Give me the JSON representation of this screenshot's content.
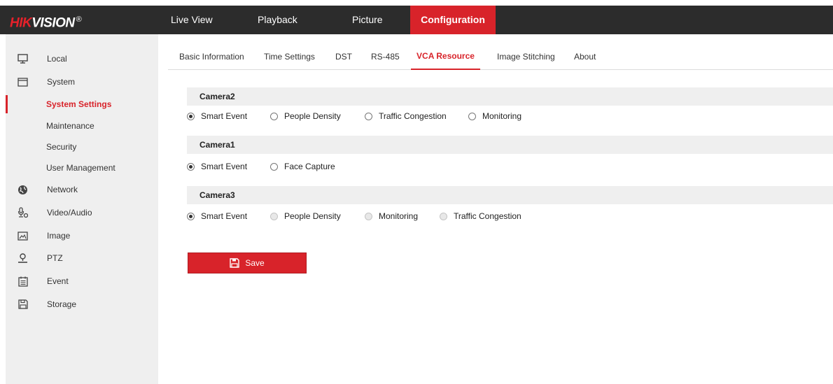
{
  "brand": {
    "hik": "HIK",
    "vision": "VISION",
    "reg": "®"
  },
  "topnav": {
    "live_view": "Live View",
    "playback": "Playback",
    "picture": "Picture",
    "configuration": "Configuration"
  },
  "sidebar": {
    "items": [
      {
        "label": "Local",
        "icon": "monitor-icon"
      },
      {
        "label": "System",
        "icon": "window-icon"
      },
      {
        "label": "System Settings",
        "active": true
      },
      {
        "label": "Maintenance"
      },
      {
        "label": "Security"
      },
      {
        "label": "User Management"
      },
      {
        "label": "Network",
        "icon": "globe-icon"
      },
      {
        "label": "Video/Audio",
        "icon": "microphone-icon"
      },
      {
        "label": "Image",
        "icon": "image-icon"
      },
      {
        "label": "PTZ",
        "icon": "ptz-camera-icon"
      },
      {
        "label": "Event",
        "icon": "calendar-icon"
      },
      {
        "label": "Storage",
        "icon": "floppy-disk-icon"
      }
    ]
  },
  "tabs": {
    "basic_information": "Basic Information",
    "time_settings": "Time Settings",
    "dst": "DST",
    "rs485": "RS-485",
    "vca_resource": "VCA Resource",
    "image_stitching": "Image Stitching",
    "about": "About",
    "active": "VCA Resource"
  },
  "cameras": [
    {
      "name": "Camera2",
      "options": [
        {
          "label": "Smart Event",
          "checked": true,
          "disabled": false
        },
        {
          "label": "People Density",
          "checked": false,
          "disabled": false
        },
        {
          "label": "Traffic Congestion",
          "checked": false,
          "disabled": false
        },
        {
          "label": "Monitoring",
          "checked": false,
          "disabled": false
        }
      ]
    },
    {
      "name": "Camera1",
      "options": [
        {
          "label": "Smart Event",
          "checked": true,
          "disabled": false
        },
        {
          "label": "Face Capture",
          "checked": false,
          "disabled": false
        }
      ]
    },
    {
      "name": "Camera3",
      "options": [
        {
          "label": "Smart Event",
          "checked": true,
          "disabled": false
        },
        {
          "label": "People Density",
          "checked": false,
          "disabled": true
        },
        {
          "label": "Monitoring",
          "checked": false,
          "disabled": true
        },
        {
          "label": "Traffic Congestion",
          "checked": false,
          "disabled": true
        }
      ]
    }
  ],
  "save_button": {
    "label": "Save",
    "icon": "save-icon"
  },
  "colors": {
    "accent": "#d8232a",
    "topbar": "#2c2c2c",
    "sidebar_bg": "#efefef",
    "section_bg": "#efefef"
  }
}
